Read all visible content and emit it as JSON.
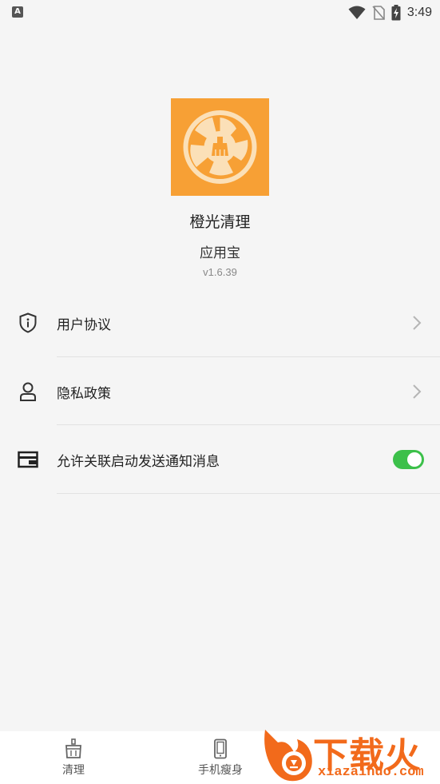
{
  "status_bar": {
    "indicator_letter": "A",
    "time": "3:49",
    "icons": [
      "wifi-icon",
      "no-sim-icon",
      "battery-charging-icon"
    ]
  },
  "app": {
    "name": "橙光清理",
    "source": "应用宝",
    "version": "v1.6.39",
    "logo_bg": "#f7a035"
  },
  "settings": {
    "items": [
      {
        "label": "用户协议",
        "icon": "shield-info-icon",
        "type": "link"
      },
      {
        "label": "隐私政策",
        "icon": "person-icon",
        "type": "link"
      },
      {
        "label": "允许关联启动发送通知消息",
        "icon": "wallet-icon",
        "type": "toggle",
        "enabled": true
      }
    ],
    "toggle_color": "#3cc04a"
  },
  "bottom_nav": {
    "items": [
      {
        "label": "清理",
        "icon": "basket-icon"
      },
      {
        "label": "手机瘦身",
        "icon": "phone-icon"
      }
    ]
  },
  "watermark": {
    "text": "下载火",
    "url": "xiazaihuo.com",
    "color": "#f26a1b"
  }
}
